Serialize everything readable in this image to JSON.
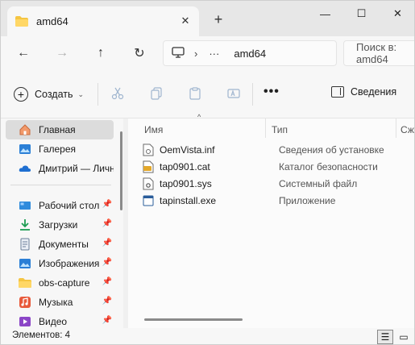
{
  "window": {
    "tab_title": "amd64",
    "tab_close": "✕",
    "new_tab": "+",
    "minimize": "—",
    "maximize": "☐",
    "close": "✕"
  },
  "navigation": {
    "back": "←",
    "forward": "→",
    "up": "↑",
    "refresh": "↻",
    "breadcrumb_ellipsis": "···",
    "breadcrumb_sep": "›",
    "current_folder": "amd64",
    "search_placeholder": "Поиск в: amd64"
  },
  "toolbar": {
    "create_label": "Создать",
    "create_chevron": "⌄",
    "more": "•••",
    "details_label": "Сведения"
  },
  "sidebar": {
    "items": [
      {
        "label": "Главная",
        "icon": "home-icon",
        "active": true
      },
      {
        "label": "Галерея",
        "icon": "gallery-icon"
      },
      {
        "label": "Дмитрий — Личное",
        "icon": "onedrive-cloud-icon"
      },
      {
        "label": "Рабочий стол",
        "icon": "desktop-icon",
        "pinned": true
      },
      {
        "label": "Загрузки",
        "icon": "downloads-icon",
        "pinned": true
      },
      {
        "label": "Документы",
        "icon": "documents-icon",
        "pinned": true
      },
      {
        "label": "Изображения",
        "icon": "pictures-icon",
        "pinned": true
      },
      {
        "label": "obs-capture",
        "icon": "folder-icon",
        "pinned": true
      },
      {
        "label": "Музыка",
        "icon": "music-icon",
        "pinned": true
      },
      {
        "label": "Видео",
        "icon": "videos-icon",
        "pinned": true
      }
    ],
    "pin_glyph": "📌"
  },
  "file_list": {
    "columns": [
      "Имя",
      "Тип",
      "Сж"
    ],
    "sort_glyph": "^",
    "rows": [
      {
        "name": "OemVista.inf",
        "type": "Сведения об установке",
        "icon": "inf-file-icon"
      },
      {
        "name": "tap0901.cat",
        "type": "Каталог безопасности",
        "icon": "cat-file-icon"
      },
      {
        "name": "tap0901.sys",
        "type": "Системный файл",
        "icon": "sys-file-icon"
      },
      {
        "name": "tapinstall.exe",
        "type": "Приложение",
        "icon": "exe-file-icon"
      }
    ]
  },
  "status_bar": {
    "item_count": "Элементов: 4",
    "details_view_glyph": "☰",
    "tiles_view_glyph": "▭"
  },
  "colors": {
    "folder_yellow": "#f5c542",
    "accent_blue": "#1f6fd1",
    "selected_bg": "#dcdcdc"
  }
}
